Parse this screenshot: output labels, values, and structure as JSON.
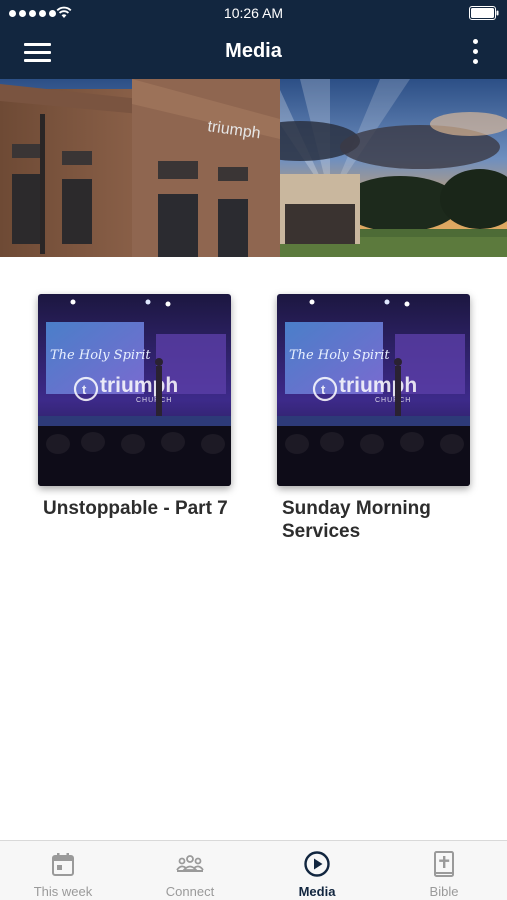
{
  "status_bar": {
    "time": "10:26 AM"
  },
  "header": {
    "title": "Media",
    "menu_icon": "hamburger-menu-icon",
    "more_icon": "more-vertical-icon"
  },
  "hero": {
    "sign_text": "triumph"
  },
  "cards": [
    {
      "title": "Unstoppable - Part 7",
      "thumb_script": "The Holy Spirit",
      "thumb_logo": "triumph",
      "thumb_logo_sub": "CHURCH"
    },
    {
      "title": "Sunday Morning Services",
      "thumb_script": "The Holy Spirit",
      "thumb_logo": "triumph",
      "thumb_logo_sub": "CHURCH"
    }
  ],
  "tabs": [
    {
      "label": "This week",
      "icon": "calendar-icon",
      "active": false
    },
    {
      "label": "Connect",
      "icon": "people-group-icon",
      "active": false
    },
    {
      "label": "Media",
      "icon": "play-circle-icon",
      "active": true
    },
    {
      "label": "Bible",
      "icon": "bible-book-icon",
      "active": false
    }
  ],
  "colors": {
    "header_bg": "#12263f",
    "active_tab": "#12263f",
    "inactive_tab": "#9a9a9a"
  }
}
